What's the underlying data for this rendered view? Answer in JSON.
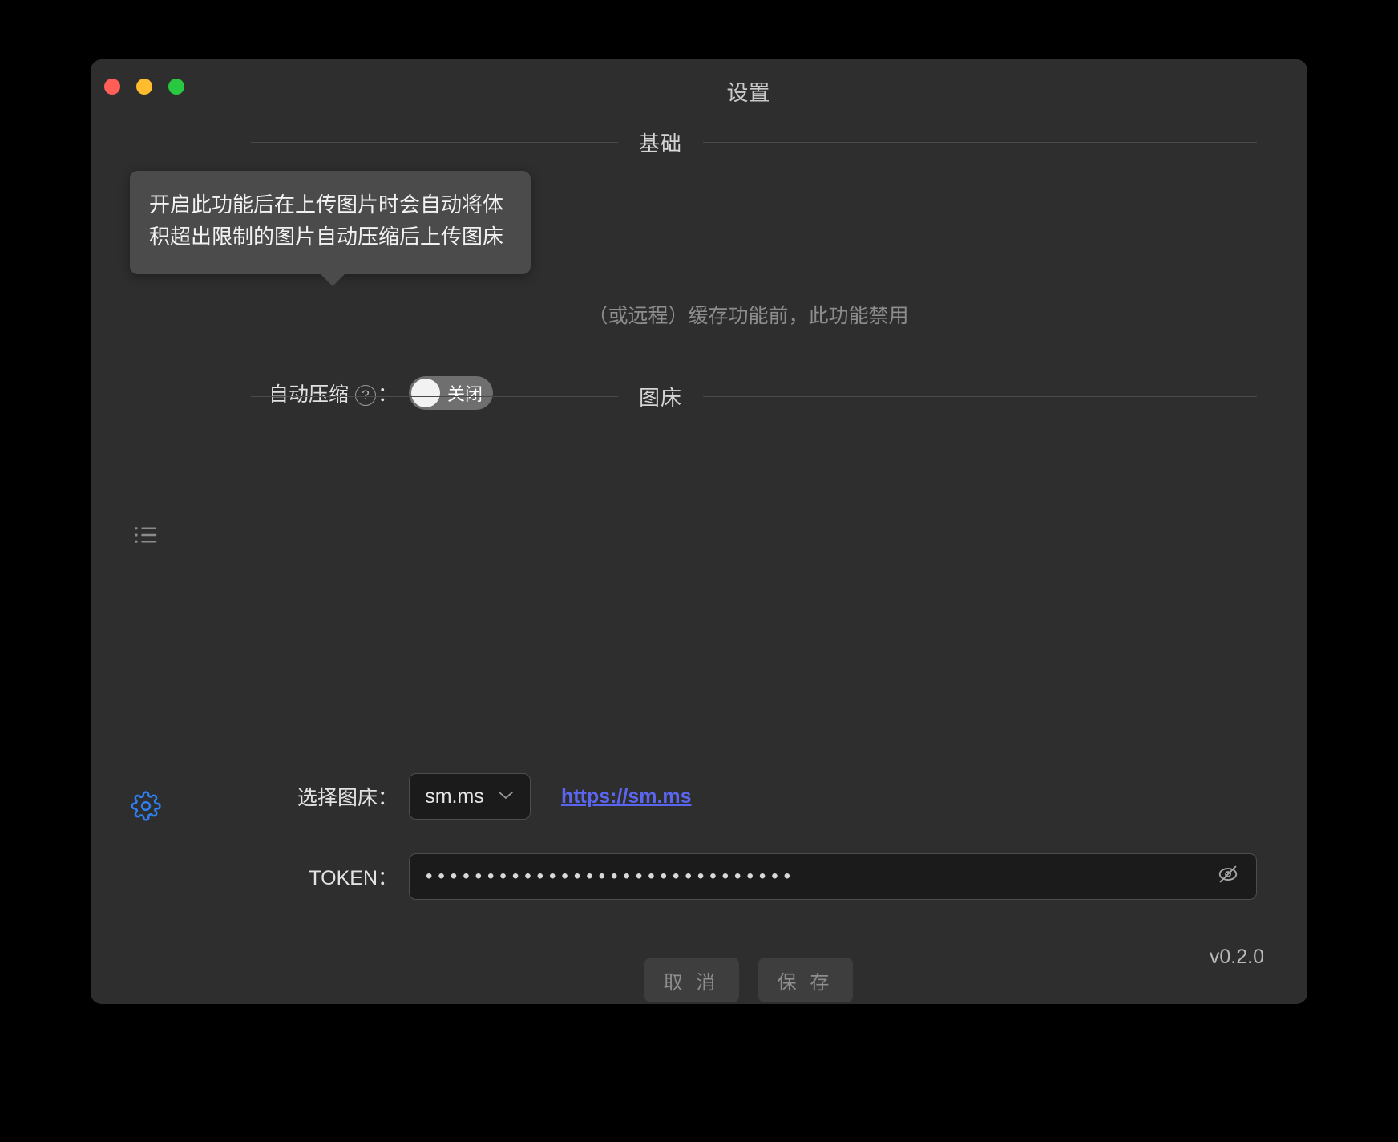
{
  "window": {
    "title": "设置",
    "traffic_lights": [
      {
        "name": "close",
        "color": "#ff5f57"
      },
      {
        "name": "minimize",
        "color": "#febc2e"
      },
      {
        "name": "maximize",
        "color": "#28c840"
      }
    ]
  },
  "sidebar": {
    "items": [
      {
        "icon": "cloud-upload-icon",
        "active": false
      },
      {
        "icon": "list-icon",
        "active": false
      },
      {
        "icon": "gear-icon",
        "active": true
      }
    ]
  },
  "sections": {
    "basic": {
      "title": "基础",
      "obscured_note": "（或远程）缓存功能前，此功能禁用",
      "compress": {
        "label": "自动压缩",
        "help_glyph": "?",
        "colon": "：",
        "toggle_state": "关闭"
      }
    },
    "storage": {
      "title": "图床",
      "select": {
        "label": "选择图床：",
        "value": "sm.ms",
        "chevron": "⌄",
        "options": [
          "sm.ms"
        ]
      },
      "link": "https://sm.ms",
      "token": {
        "label": "TOKEN：",
        "masked_value": "••••••••••••••••••••••••••••••",
        "placeholder": "",
        "reveal_icon": "eye-off-icon"
      }
    }
  },
  "actions": {
    "cancel_label": "取 消",
    "save_label": "保 存"
  },
  "footer": {
    "version": "v0.2.0"
  },
  "tooltip": {
    "text": "开启此功能后在上传图片时会自动将体积超出限制的图片自动压缩后上传图床"
  },
  "colors": {
    "window_bg": "#2e2e2e",
    "field_bg": "#1b1b1b",
    "accent_link": "#5b66f0",
    "accent_active_icon": "#2f7ff0",
    "tooltip_bg": "#4b4b4b"
  }
}
